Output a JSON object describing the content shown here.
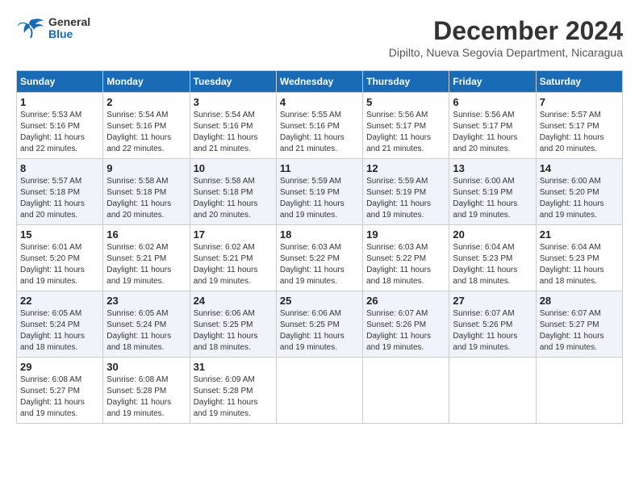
{
  "logo": {
    "general": "General",
    "blue": "Blue"
  },
  "title": "December 2024",
  "subtitle": "Dipilto, Nueva Segovia Department, Nicaragua",
  "days_of_week": [
    "Sunday",
    "Monday",
    "Tuesday",
    "Wednesday",
    "Thursday",
    "Friday",
    "Saturday"
  ],
  "weeks": [
    [
      {
        "day": "1",
        "sunrise": "5:53 AM",
        "sunset": "5:16 PM",
        "daylight": "11 hours and 22 minutes."
      },
      {
        "day": "2",
        "sunrise": "5:54 AM",
        "sunset": "5:16 PM",
        "daylight": "11 hours and 22 minutes."
      },
      {
        "day": "3",
        "sunrise": "5:54 AM",
        "sunset": "5:16 PM",
        "daylight": "11 hours and 21 minutes."
      },
      {
        "day": "4",
        "sunrise": "5:55 AM",
        "sunset": "5:16 PM",
        "daylight": "11 hours and 21 minutes."
      },
      {
        "day": "5",
        "sunrise": "5:56 AM",
        "sunset": "5:17 PM",
        "daylight": "11 hours and 21 minutes."
      },
      {
        "day": "6",
        "sunrise": "5:56 AM",
        "sunset": "5:17 PM",
        "daylight": "11 hours and 20 minutes."
      },
      {
        "day": "7",
        "sunrise": "5:57 AM",
        "sunset": "5:17 PM",
        "daylight": "11 hours and 20 minutes."
      }
    ],
    [
      {
        "day": "8",
        "sunrise": "5:57 AM",
        "sunset": "5:18 PM",
        "daylight": "11 hours and 20 minutes."
      },
      {
        "day": "9",
        "sunrise": "5:58 AM",
        "sunset": "5:18 PM",
        "daylight": "11 hours and 20 minutes."
      },
      {
        "day": "10",
        "sunrise": "5:58 AM",
        "sunset": "5:18 PM",
        "daylight": "11 hours and 20 minutes."
      },
      {
        "day": "11",
        "sunrise": "5:59 AM",
        "sunset": "5:19 PM",
        "daylight": "11 hours and 19 minutes."
      },
      {
        "day": "12",
        "sunrise": "5:59 AM",
        "sunset": "5:19 PM",
        "daylight": "11 hours and 19 minutes."
      },
      {
        "day": "13",
        "sunrise": "6:00 AM",
        "sunset": "5:19 PM",
        "daylight": "11 hours and 19 minutes."
      },
      {
        "day": "14",
        "sunrise": "6:00 AM",
        "sunset": "5:20 PM",
        "daylight": "11 hours and 19 minutes."
      }
    ],
    [
      {
        "day": "15",
        "sunrise": "6:01 AM",
        "sunset": "5:20 PM",
        "daylight": "11 hours and 19 minutes."
      },
      {
        "day": "16",
        "sunrise": "6:02 AM",
        "sunset": "5:21 PM",
        "daylight": "11 hours and 19 minutes."
      },
      {
        "day": "17",
        "sunrise": "6:02 AM",
        "sunset": "5:21 PM",
        "daylight": "11 hours and 19 minutes."
      },
      {
        "day": "18",
        "sunrise": "6:03 AM",
        "sunset": "5:22 PM",
        "daylight": "11 hours and 19 minutes."
      },
      {
        "day": "19",
        "sunrise": "6:03 AM",
        "sunset": "5:22 PM",
        "daylight": "11 hours and 18 minutes."
      },
      {
        "day": "20",
        "sunrise": "6:04 AM",
        "sunset": "5:23 PM",
        "daylight": "11 hours and 18 minutes."
      },
      {
        "day": "21",
        "sunrise": "6:04 AM",
        "sunset": "5:23 PM",
        "daylight": "11 hours and 18 minutes."
      }
    ],
    [
      {
        "day": "22",
        "sunrise": "6:05 AM",
        "sunset": "5:24 PM",
        "daylight": "11 hours and 18 minutes."
      },
      {
        "day": "23",
        "sunrise": "6:05 AM",
        "sunset": "5:24 PM",
        "daylight": "11 hours and 18 minutes."
      },
      {
        "day": "24",
        "sunrise": "6:06 AM",
        "sunset": "5:25 PM",
        "daylight": "11 hours and 18 minutes."
      },
      {
        "day": "25",
        "sunrise": "6:06 AM",
        "sunset": "5:25 PM",
        "daylight": "11 hours and 19 minutes."
      },
      {
        "day": "26",
        "sunrise": "6:07 AM",
        "sunset": "5:26 PM",
        "daylight": "11 hours and 19 minutes."
      },
      {
        "day": "27",
        "sunrise": "6:07 AM",
        "sunset": "5:26 PM",
        "daylight": "11 hours and 19 minutes."
      },
      {
        "day": "28",
        "sunrise": "6:07 AM",
        "sunset": "5:27 PM",
        "daylight": "11 hours and 19 minutes."
      }
    ],
    [
      {
        "day": "29",
        "sunrise": "6:08 AM",
        "sunset": "5:27 PM",
        "daylight": "11 hours and 19 minutes."
      },
      {
        "day": "30",
        "sunrise": "6:08 AM",
        "sunset": "5:28 PM",
        "daylight": "11 hours and 19 minutes."
      },
      {
        "day": "31",
        "sunrise": "6:09 AM",
        "sunset": "5:28 PM",
        "daylight": "11 hours and 19 minutes."
      },
      null,
      null,
      null,
      null
    ]
  ]
}
